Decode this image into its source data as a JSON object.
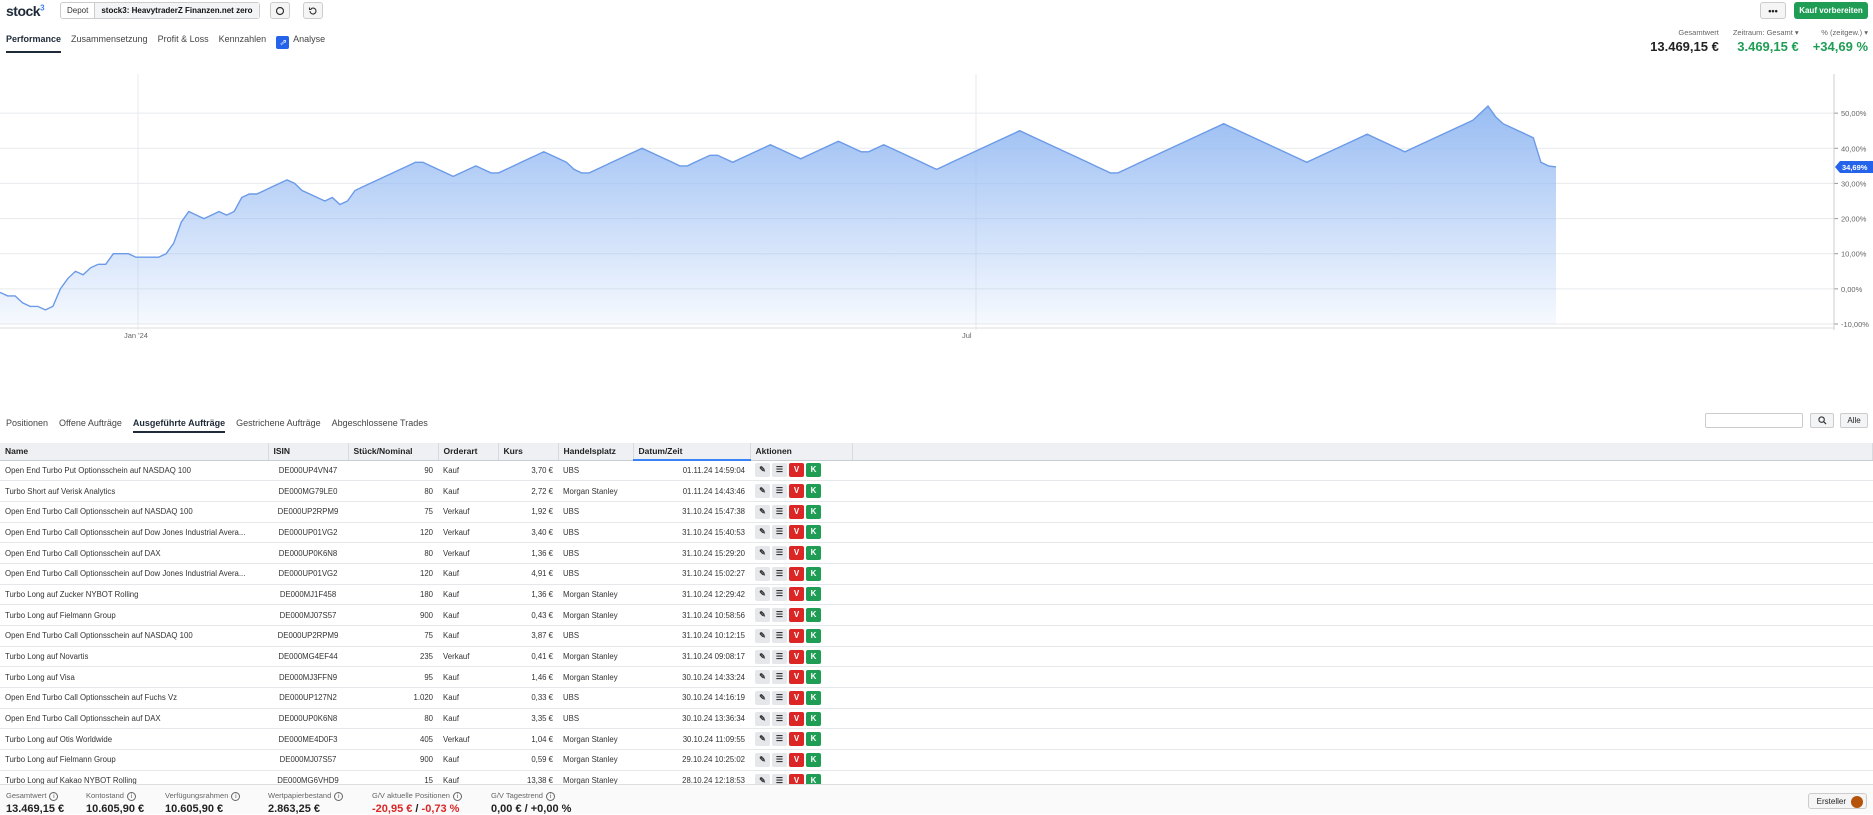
{
  "app": {
    "logo": "stock",
    "logo_sup": "3"
  },
  "depot": {
    "label": "Depot",
    "value": "stock3: HeavytraderZ Finanzen.net zero"
  },
  "top_actions": {
    "more_label": "•••",
    "buy_label": "Kauf vorbereiten"
  },
  "main_tabs": [
    {
      "label": "Performance",
      "active": true
    },
    {
      "label": "Zusammensetzung"
    },
    {
      "label": "Profit & Loss"
    },
    {
      "label": "Kennzahlen"
    },
    {
      "label": "Analyse"
    }
  ],
  "kpis": [
    {
      "label": "Gesamtwert",
      "value": "13.469,15 €"
    },
    {
      "label": "Zeitraum: Gesamt ▾",
      "value": "3.469,15 €"
    },
    {
      "label": "% (zeitgew.) ▾",
      "value": "+34,69 %"
    }
  ],
  "colors": {
    "accent": "#3b82f6",
    "green": "#1f9d55",
    "red": "#dc2626",
    "area_fill": "#93b9f2",
    "line": "#6b9ae8"
  },
  "chart_data": {
    "type": "area",
    "y_ticks": [
      "50,00%",
      "40,00%",
      "30,00%",
      "20,00%",
      "10,00%",
      "0,00%",
      "-10,00%"
    ],
    "x_ticks": [
      "Jan '24",
      "Jul"
    ],
    "ylim": [
      -10,
      60
    ],
    "current_label": "34,69%",
    "values": [
      -1,
      -2,
      -2,
      -4,
      -5,
      -5,
      -6,
      -5,
      0,
      3,
      5,
      4,
      6,
      7,
      7,
      10,
      10,
      10,
      9,
      9,
      9,
      9,
      10,
      13,
      19,
      22,
      21,
      20,
      21,
      22,
      21,
      22,
      26,
      27,
      27,
      28,
      29,
      30,
      31,
      30,
      28,
      27,
      26,
      25,
      26,
      24,
      25,
      28,
      29,
      30,
      31,
      32,
      33,
      34,
      35,
      36,
      36,
      35,
      34,
      33,
      32,
      33,
      34,
      35,
      34,
      33,
      33,
      34,
      35,
      36,
      37,
      38,
      39,
      38,
      37,
      36,
      34,
      33,
      33,
      34,
      35,
      36,
      37,
      38,
      39,
      40,
      39,
      38,
      37,
      36,
      35,
      35,
      36,
      37,
      38,
      38,
      37,
      36,
      37,
      38,
      39,
      40,
      41,
      40,
      39,
      38,
      37,
      38,
      39,
      40,
      41,
      42,
      41,
      40,
      39,
      39,
      40,
      41,
      40,
      39,
      38,
      37,
      36,
      35,
      34,
      35,
      36,
      37,
      38,
      39,
      40,
      41,
      42,
      43,
      44,
      45,
      44,
      43,
      42,
      41,
      40,
      39,
      38,
      37,
      36,
      35,
      34,
      33,
      33,
      34,
      35,
      36,
      37,
      38,
      39,
      40,
      41,
      42,
      43,
      44,
      45,
      46,
      47,
      46,
      45,
      44,
      43,
      42,
      41,
      40,
      39,
      38,
      37,
      36,
      37,
      38,
      39,
      40,
      41,
      42,
      43,
      44,
      43,
      42,
      41,
      40,
      39,
      40,
      41,
      42,
      43,
      44,
      45,
      46,
      47,
      48,
      50,
      52,
      49,
      47,
      46,
      45,
      44,
      43,
      36,
      35,
      34.69
    ]
  },
  "sub_tabs": [
    {
      "label": "Positionen"
    },
    {
      "label": "Offene Aufträge"
    },
    {
      "label": "Ausgeführte Aufträge",
      "active": true
    },
    {
      "label": "Gestrichene Aufträge"
    },
    {
      "label": "Abgeschlossene Trades"
    }
  ],
  "filter": {
    "alle_label": "Alle",
    "search_placeholder": ""
  },
  "table": {
    "headers": [
      "Name",
      "ISIN",
      "Stück/Nominal",
      "Orderart",
      "Kurs",
      "Handelsplatz",
      "Datum/Zeit",
      "Aktionen"
    ],
    "rows": [
      [
        "Open End Turbo Put Optionsschein auf NASDAQ 100",
        "DE000UP4VN47",
        "90",
        "Kauf",
        "3,70 €",
        "UBS",
        "01.11.24 14:59:04"
      ],
      [
        "Turbo Short auf Verisk Analytics",
        "DE000MG79LE0",
        "80",
        "Kauf",
        "2,72 €",
        "Morgan Stanley",
        "01.11.24 14:43:46"
      ],
      [
        "Open End Turbo Call Optionsschein auf NASDAQ 100",
        "DE000UP2RPM9",
        "75",
        "Verkauf",
        "1,92 €",
        "UBS",
        "31.10.24 15:47:38"
      ],
      [
        "Open End Turbo Call Optionsschein auf Dow Jones Industrial Avera...",
        "DE000UP01VG2",
        "120",
        "Verkauf",
        "3,40 €",
        "UBS",
        "31.10.24 15:40:53"
      ],
      [
        "Open End Turbo Call Optionsschein auf DAX",
        "DE000UP0K6N8",
        "80",
        "Verkauf",
        "1,36 €",
        "UBS",
        "31.10.24 15:29:20"
      ],
      [
        "Open End Turbo Call Optionsschein auf Dow Jones Industrial Avera...",
        "DE000UP01VG2",
        "120",
        "Kauf",
        "4,91 €",
        "UBS",
        "31.10.24 15:02:27"
      ],
      [
        "Turbo Long auf Zucker NYBOT Rolling",
        "DE000MJ1F458",
        "180",
        "Kauf",
        "1,36 €",
        "Morgan Stanley",
        "31.10.24 12:29:42"
      ],
      [
        "Turbo Long auf Fielmann Group",
        "DE000MJ07S57",
        "900",
        "Kauf",
        "0,43 €",
        "Morgan Stanley",
        "31.10.24 10:58:56"
      ],
      [
        "Open End Turbo Call Optionsschein auf NASDAQ 100",
        "DE000UP2RPM9",
        "75",
        "Kauf",
        "3,87 €",
        "UBS",
        "31.10.24 10:12:15"
      ],
      [
        "Turbo Long auf Novartis",
        "DE000MG4EF44",
        "235",
        "Verkauf",
        "0,41 €",
        "Morgan Stanley",
        "31.10.24 09:08:17"
      ],
      [
        "Turbo Long auf Visa",
        "DE000MJ3FFN9",
        "95",
        "Kauf",
        "1,46 €",
        "Morgan Stanley",
        "30.10.24 14:33:24"
      ],
      [
        "Open End Turbo Call Optionsschein auf Fuchs Vz",
        "DE000UP127N2",
        "1.020",
        "Kauf",
        "0,33 €",
        "UBS",
        "30.10.24 14:16:19"
      ],
      [
        "Open End Turbo Call Optionsschein auf DAX",
        "DE000UP0K6N8",
        "80",
        "Kauf",
        "3,35 €",
        "UBS",
        "30.10.24 13:36:34"
      ],
      [
        "Turbo Long auf Otis Worldwide",
        "DE000ME4D0F3",
        "405",
        "Verkauf",
        "1,04 €",
        "Morgan Stanley",
        "30.10.24 11:09:55"
      ],
      [
        "Turbo Long auf Fielmann Group",
        "DE000MJ07S57",
        "900",
        "Kauf",
        "0,59 €",
        "Morgan Stanley",
        "29.10.24 10:25:02"
      ],
      [
        "Turbo Long auf Kakao NYBOT Rolling",
        "DE000MG6VHD9",
        "15",
        "Kauf",
        "13,38 €",
        "Morgan Stanley",
        "28.10.24 12:18:53"
      ]
    ],
    "action_v": "V",
    "action_k": "K"
  },
  "footer": [
    {
      "label": "Gesamtwert",
      "value": "13.469,15 €"
    },
    {
      "label": "Kontostand",
      "value": "10.605,90 €"
    },
    {
      "label": "Verfügungsrahmen",
      "value": "10.605,90 €"
    },
    {
      "label": "Wertpapierbestand",
      "value": "2.863,25 €"
    },
    {
      "label": "G/V aktuelle Positionen",
      "value_a": "-20,95 €",
      "sep": " / ",
      "value_b": "-0,73 %"
    },
    {
      "label": "G/V Tagestrend",
      "value": "0,00 € / +0,00 %"
    }
  ],
  "ersteller": {
    "label": "Ersteller"
  }
}
